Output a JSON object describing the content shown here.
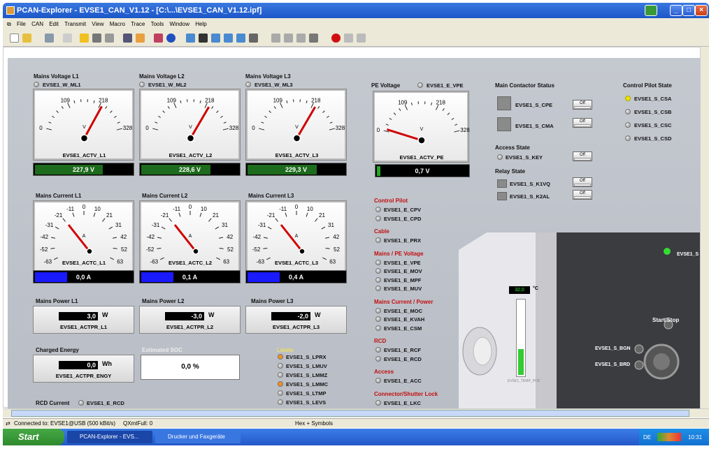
{
  "window": {
    "title": "PCAN-Explorer - EVSE1_CAN_V1.12 - [C:\\...\\EVSE1_CAN_V1.12.ipf]"
  },
  "menu": [
    "File",
    "CAN",
    "Edit",
    "Transmit",
    "View",
    "Macro",
    "Trace",
    "Tools",
    "Window",
    "Help"
  ],
  "voltage": [
    {
      "title": "Mains Voltage L1",
      "sig": "EVSE1_W_ML1",
      "gauge_sig": "EVSE1_ACTV_L1",
      "value": "227,9 V",
      "level": 0.69
    },
    {
      "title": "Mains Voltage L2",
      "sig": "EVSE1_W_ML2",
      "gauge_sig": "EVSE1_ACTV_L2",
      "value": "228,6 V",
      "level": 0.7
    },
    {
      "title": "Mains Voltage L3",
      "sig": "EVSE1_W_ML3",
      "gauge_sig": "EVSE1_ACTV_L3",
      "value": "229,3 V",
      "level": 0.7
    }
  ],
  "voltage_ticks": [
    "0",
    "109",
    "218",
    "328"
  ],
  "voltage_unit": "V",
  "pe": {
    "title": "PE Voltage",
    "sig": "EVSE1_E_VPE",
    "gauge_sig": "EVSE1_ACTV_PE",
    "value": "0,7 V",
    "level": 0.02
  },
  "current": [
    {
      "title": "Mains Current L1",
      "gauge_sig": "EVSE1_ACTC_L1",
      "value": "0,0 A"
    },
    {
      "title": "Mains Current L2",
      "gauge_sig": "EVSE1_ACTC_L2",
      "value": "0,1 A"
    },
    {
      "title": "Mains Current L3",
      "gauge_sig": "EVSE1_ACTC_L3",
      "value": "0,4 A"
    }
  ],
  "current_ticks": [
    "-63",
    "-52",
    "-42",
    "-31",
    "-21",
    "-11",
    "0",
    "10",
    "21",
    "31",
    "42",
    "52",
    "63"
  ],
  "current_unit": "A",
  "power": [
    {
      "title": "Mains Power L1",
      "value": "3,0",
      "unit": "W",
      "sig": "EVSE1_ACTPR_L1"
    },
    {
      "title": "Mains Power L2",
      "value": "-3,0",
      "unit": "W",
      "sig": "EVSE1_ACTPR_L2"
    },
    {
      "title": "Mains Power L3",
      "value": "-2,0",
      "unit": "W",
      "sig": "EVSE1_ACTPR_L3"
    }
  ],
  "energy": {
    "title": "Charged Energy",
    "value": "0,0",
    "unit": "Wh",
    "sig": "EVSE1_ACTPR_ENGY"
  },
  "soc": {
    "title": "Estimated SOC",
    "value": "0,0 %"
  },
  "rcd": {
    "title": "RCD Current",
    "sig": "EVSE1_E_RCD"
  },
  "limits": {
    "title": "Limits",
    "items": [
      "EVSE1_S_LPRX",
      "EVSE1_S_LMUV",
      "EVSE1_S_LMMZ",
      "EVSE1_S_LMMC",
      "EVSE1_S_LTMP",
      "EVSE1_S_LEVS"
    ]
  },
  "error_groups": [
    {
      "title": "Control Pilot",
      "items": [
        "EVSE1_E_CPV",
        "EVSE1_E_CPD"
      ]
    },
    {
      "title": "Cable",
      "items": [
        "EVSE1_E_PRX"
      ]
    },
    {
      "title": "Mains / PE Voltage",
      "items": [
        "EVSE1_E_VPE",
        "EVSE1_E_MOV",
        "EVSE1_E_MPF",
        "EVSE1_E_MUV"
      ]
    },
    {
      "title": "Mains Current / Power",
      "items": [
        "EVSE1_E_MOC",
        "EVSE1_E_KVAH",
        "EVSE1_E_CSM"
      ]
    },
    {
      "title": "RCD",
      "items": [
        "EVSE1_E_RCF",
        "EVSE1_E_RCD"
      ]
    },
    {
      "title": "Access",
      "items": [
        "EVSE1_E_ACC"
      ]
    },
    {
      "title": "Connector/Shutter Lock",
      "items": [
        "EVSE1_E_LKC"
      ]
    }
  ],
  "contactor": {
    "title": "Main Contactor Status",
    "items": [
      "EVSE1_S_CPE",
      "EVSE1_S_CMA"
    ]
  },
  "access": {
    "title": "Access State",
    "sig": "EVSE1_S_KEY"
  },
  "relay": {
    "title": "Relay State",
    "items": [
      "EVSE1_S_K1VQ",
      "EVSE1_S_K2AL"
    ]
  },
  "off_label": "Off",
  "cp_state": {
    "title": "Control Pilot State",
    "items": [
      "EVSE1_S_CSA",
      "EVSE1_S_CSB",
      "EVSE1_S_CSC",
      "EVSE1_S_CSD"
    ]
  },
  "evse": {
    "temp_value": "32,0",
    "temp_unit": "°C",
    "temp_level": 0.35,
    "temp_sig": "EVSE1_TEMP_PCB",
    "status_sig": "EVSE1_S",
    "start_stop": "Start/Stop",
    "bgn": "EVSE1_S_BGN",
    "brd": "EVSE1_S_BRD"
  },
  "status": {
    "connection": "Connected to: EVSE1@USB (500 kBit/s)",
    "qxmt": "QXmtFull: 0",
    "mode": "Hex + Symbols"
  },
  "taskbar": {
    "start": "Start",
    "tasks": [
      "PCAN-Explorer - EVS...",
      "Drucker und Faxgeräte"
    ],
    "lang": "DE",
    "time": "10:31"
  },
  "colors": {
    "voltage_bar": "#1d6b1d",
    "current_bar": "#1a1aff",
    "needle": "#d00000",
    "led_on": "#33dd33",
    "cp_led": "#f0e000",
    "title_blue": "#2458c8"
  }
}
